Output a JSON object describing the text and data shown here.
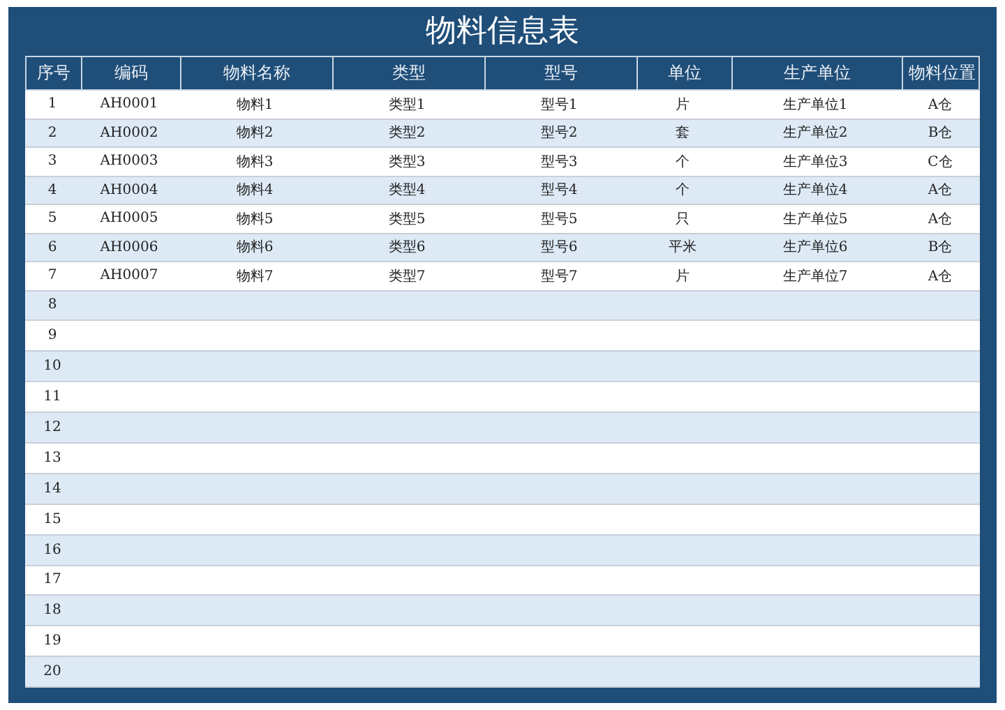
{
  "title": "物料信息表",
  "columns": [
    "序号",
    "编码",
    "物料名称",
    "类型",
    "型号",
    "单位",
    "生产单位",
    "物料位置"
  ],
  "rows": [
    {
      "cells": [
        "1",
        "AH0001",
        "物料1",
        "类型1",
        "型号1",
        "片",
        "生产单位1",
        "A仓"
      ]
    },
    {
      "cells": [
        "2",
        "AH0002",
        "物料2",
        "类型2",
        "型号2",
        "套",
        "生产单位2",
        "B仓"
      ]
    },
    {
      "cells": [
        "3",
        "AH0003",
        "物料3",
        "类型3",
        "型号3",
        "个",
        "生产单位3",
        "C仓"
      ]
    },
    {
      "cells": [
        "4",
        "AH0004",
        "物料4",
        "类型4",
        "型号4",
        "个",
        "生产单位4",
        "A仓"
      ]
    },
    {
      "cells": [
        "5",
        "AH0005",
        "物料5",
        "类型5",
        "型号5",
        "只",
        "生产单位5",
        "A仓"
      ]
    },
    {
      "cells": [
        "6",
        "AH0006",
        "物料6",
        "类型6",
        "型号6",
        "平米",
        "生产单位6",
        "B仓"
      ]
    },
    {
      "cells": [
        "7",
        "AH0007",
        "物料7",
        "类型7",
        "型号7",
        "片",
        "生产单位7",
        "A仓"
      ]
    },
    {
      "cells": [
        "8"
      ]
    },
    {
      "cells": [
        "9"
      ]
    },
    {
      "cells": [
        "10"
      ]
    },
    {
      "cells": [
        "11"
      ]
    },
    {
      "cells": [
        "12"
      ]
    },
    {
      "cells": [
        "13"
      ]
    },
    {
      "cells": [
        "14"
      ]
    },
    {
      "cells": [
        "15"
      ]
    },
    {
      "cells": [
        "16"
      ]
    },
    {
      "cells": [
        "17"
      ]
    },
    {
      "cells": [
        "18"
      ]
    },
    {
      "cells": [
        "19"
      ]
    },
    {
      "cells": [
        "20"
      ]
    }
  ]
}
